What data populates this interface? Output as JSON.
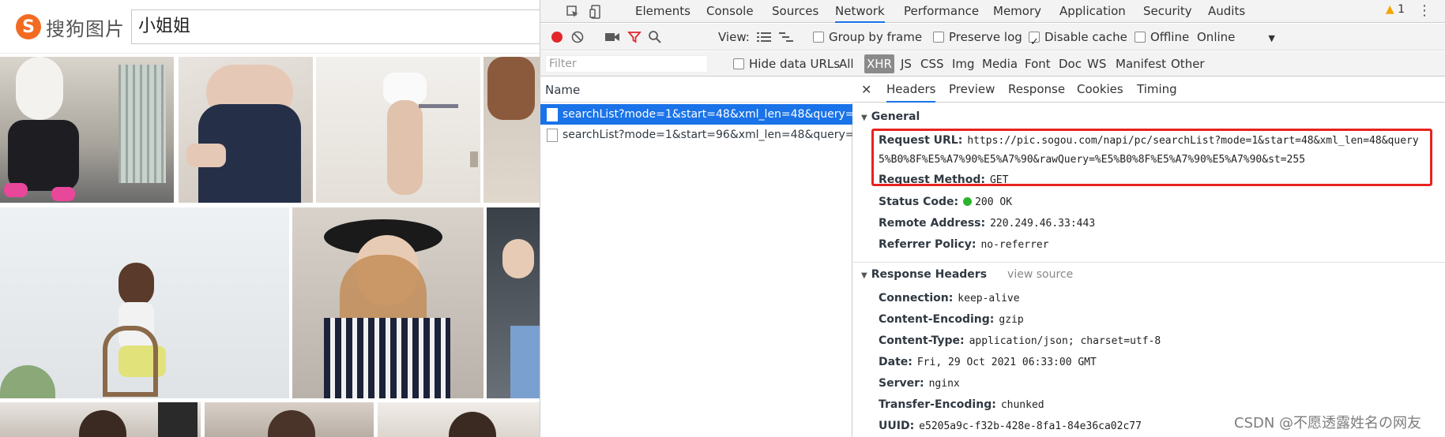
{
  "site": {
    "logo_text": "搜狗图片",
    "logo_letter": "S",
    "search_value": "小姐姐"
  },
  "devtools": {
    "tabs": [
      "Elements",
      "Console",
      "Sources",
      "Network",
      "Performance",
      "Memory",
      "Application",
      "Security",
      "Audits"
    ],
    "active_tab": "Network",
    "warning_count": "1",
    "toolbar": {
      "view_label": "View:",
      "group_by_frame": "Group by frame",
      "preserve_log": "Preserve log",
      "disable_cache": "Disable cache",
      "offline": "Offline",
      "throttle": "Online"
    },
    "filter": {
      "placeholder": "Filter",
      "hide_data_urls": "Hide data URLs",
      "types": [
        "All",
        "XHR",
        "JS",
        "CSS",
        "Img",
        "Media",
        "Font",
        "Doc",
        "WS",
        "Manifest",
        "Other"
      ],
      "selected_type": "XHR"
    },
    "requests": {
      "header": "Name",
      "rows": [
        "searchList?mode=1&start=48&xml_len=48&query=...",
        "searchList?mode=1&start=96&xml_len=48&query=..."
      ]
    },
    "detail": {
      "tabs": [
        "Headers",
        "Preview",
        "Response",
        "Cookies",
        "Timing"
      ],
      "active_tab": "Headers",
      "general_title": "General",
      "request_url_key": "Request URL:",
      "request_url_line1": "https://pic.sogou.com/napi/pc/searchList?mode=1&start=48&xml_len=48&query",
      "request_url_line2": "5%B0%8F%E5%A7%90%E5%A7%90&rawQuery=%E5%B0%8F%E5%A7%90%E5%A7%90&st=255",
      "request_method_key": "Request Method:",
      "request_method": "GET",
      "status_key": "Status Code:",
      "status": "200 OK",
      "remote_key": "Remote Address:",
      "remote": "220.249.46.33:443",
      "referrer_key": "Referrer Policy:",
      "referrer": "no-referrer",
      "response_title": "Response Headers",
      "view_source": "view source",
      "connection_key": "Connection:",
      "connection": "keep-alive",
      "encoding_key": "Content-Encoding:",
      "encoding": "gzip",
      "ctype_key": "Content-Type:",
      "ctype": "application/json; charset=utf-8",
      "date_key": "Date:",
      "date": "Fri, 29 Oct 2021 06:33:00 GMT",
      "server_key": "Server:",
      "server": "nginx",
      "transfer_key": "Transfer-Encoding:",
      "transfer": "chunked",
      "uuid_key": "UUID:",
      "uuid": "e5205a9c-f32b-428e-8fa1-84e36ca02c77"
    }
  },
  "watermark": "CSDN @不愿透露姓名の网友",
  "colors": {
    "accent": "#1a73e8",
    "highlight": "#e8231f",
    "brand": "#f26b22"
  }
}
